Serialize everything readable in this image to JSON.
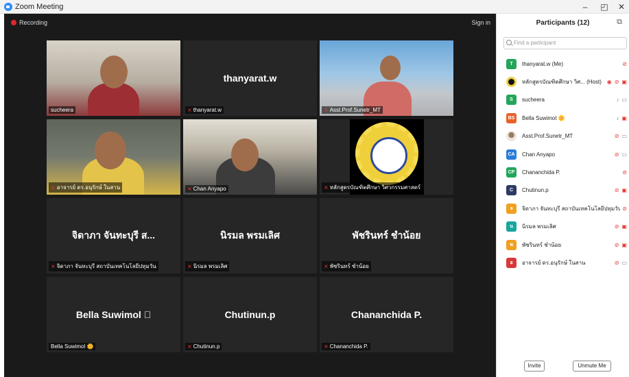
{
  "window": {
    "title": "Zoom Meeting",
    "min": "–",
    "restore": "◰",
    "close": "✕"
  },
  "meeting": {
    "recording_label": "Recording",
    "sign_in_label": "Sign in",
    "tiles": [
      {
        "big": "",
        "label": "sucheera",
        "muted": false,
        "video": "bg1"
      },
      {
        "big": "thanyarat.w",
        "label": "thanyarat.w",
        "muted": true,
        "video": ""
      },
      {
        "big": "",
        "label": "Asst.Prof.Sunetr_MT",
        "muted": true,
        "video": "bg2"
      },
      {
        "big": "",
        "label": "อาจารย์ ดร.อนุรักษ์ ในสาน",
        "muted": true,
        "video": "bg3"
      },
      {
        "big": "",
        "label": "Chan Anyapo",
        "muted": true,
        "video": "bg4"
      },
      {
        "big": "",
        "label": "หลักสูตรบัณฑิตศึกษา วิศวกรรมศาสตร์",
        "muted": true,
        "video": "logo"
      },
      {
        "big": "จิดาภา จันทะบุรี ส...",
        "label": "จิดาภา จันทะบุรี สถาบันเทคโนโลยีปทุมวัน",
        "muted": true,
        "video": ""
      },
      {
        "big": "นิรมล พรมเลิศ",
        "label": "นิรมล พรมเลิศ",
        "muted": true,
        "video": ""
      },
      {
        "big": "พัชรินทร์ ชำน้อย",
        "label": "พัชรินทร์ ชำน้อย",
        "muted": true,
        "video": ""
      },
      {
        "big": "Bella  Suwimol ⃞",
        "label": "Bella Suwimol 🌼",
        "muted": false,
        "video": ""
      },
      {
        "big": "Chutinun.p",
        "label": "Chutinun.p",
        "muted": true,
        "video": ""
      },
      {
        "big": "Chananchida P.",
        "label": "Chananchida P.",
        "muted": true,
        "video": ""
      }
    ]
  },
  "participants": {
    "title": "Participants (12)",
    "search_placeholder": "Find a participant",
    "items": [
      {
        "avatar": "T",
        "color": "#23a55a",
        "name": "thanyarat.w (Me)",
        "icons": [
          "mic-off-icon"
        ]
      },
      {
        "avatar": "",
        "color": "#111111",
        "name": "หลักสูตรบัณฑิตศึกษา วิศ...  (Host)",
        "icons": [
          "record-icon",
          "mic-off-icon",
          "video-off-icon"
        ]
      },
      {
        "avatar": "S",
        "color": "#23a55a",
        "name": "sucheera",
        "icons": [
          "mic-icon",
          "video-icon"
        ]
      },
      {
        "avatar": "BS",
        "color": "#e8622a",
        "name": "Bella Suwimol 🌼",
        "icons": [
          "mic-icon",
          "video-off-icon"
        ]
      },
      {
        "avatar": "",
        "color": "#cccccc",
        "name": "Asst.Prof.Sunetr_MT",
        "icons": [
          "mic-off-icon",
          "video-icon"
        ]
      },
      {
        "avatar": "CA",
        "color": "#2a7dd8",
        "name": "Chan Anyapo",
        "icons": [
          "mic-off-icon",
          "video-icon"
        ]
      },
      {
        "avatar": "CP",
        "color": "#23a55a",
        "name": "Chananchida P.",
        "icons": [
          "mic-off-icon"
        ]
      },
      {
        "avatar": "C",
        "color": "#2d3a66",
        "name": "Chutinun.p",
        "icons": [
          "mic-off-icon",
          "video-off-icon"
        ]
      },
      {
        "avatar": "จ",
        "color": "#f0a020",
        "name": "จิดาภา จันทะบุรี สถาบันเทคโนโลยีปทุมวัน",
        "icons": [
          "mic-off-icon"
        ]
      },
      {
        "avatar": "น",
        "color": "#1aa6a0",
        "name": "นิรมล พรมเลิศ",
        "icons": [
          "mic-off-icon",
          "video-off-icon"
        ]
      },
      {
        "avatar": "พ",
        "color": "#f0a020",
        "name": "พัชรินทร์ ชำน้อย",
        "icons": [
          "mic-off-icon",
          "video-off-icon"
        ]
      },
      {
        "avatar": "อ",
        "color": "#d93838",
        "name": "อาจารย์ ดร.อนุรักษ์ ในสาน",
        "icons": [
          "mic-off-icon",
          "video-icon"
        ]
      }
    ],
    "invite_label": "Invite",
    "unmute_label": "Unmute Me"
  }
}
